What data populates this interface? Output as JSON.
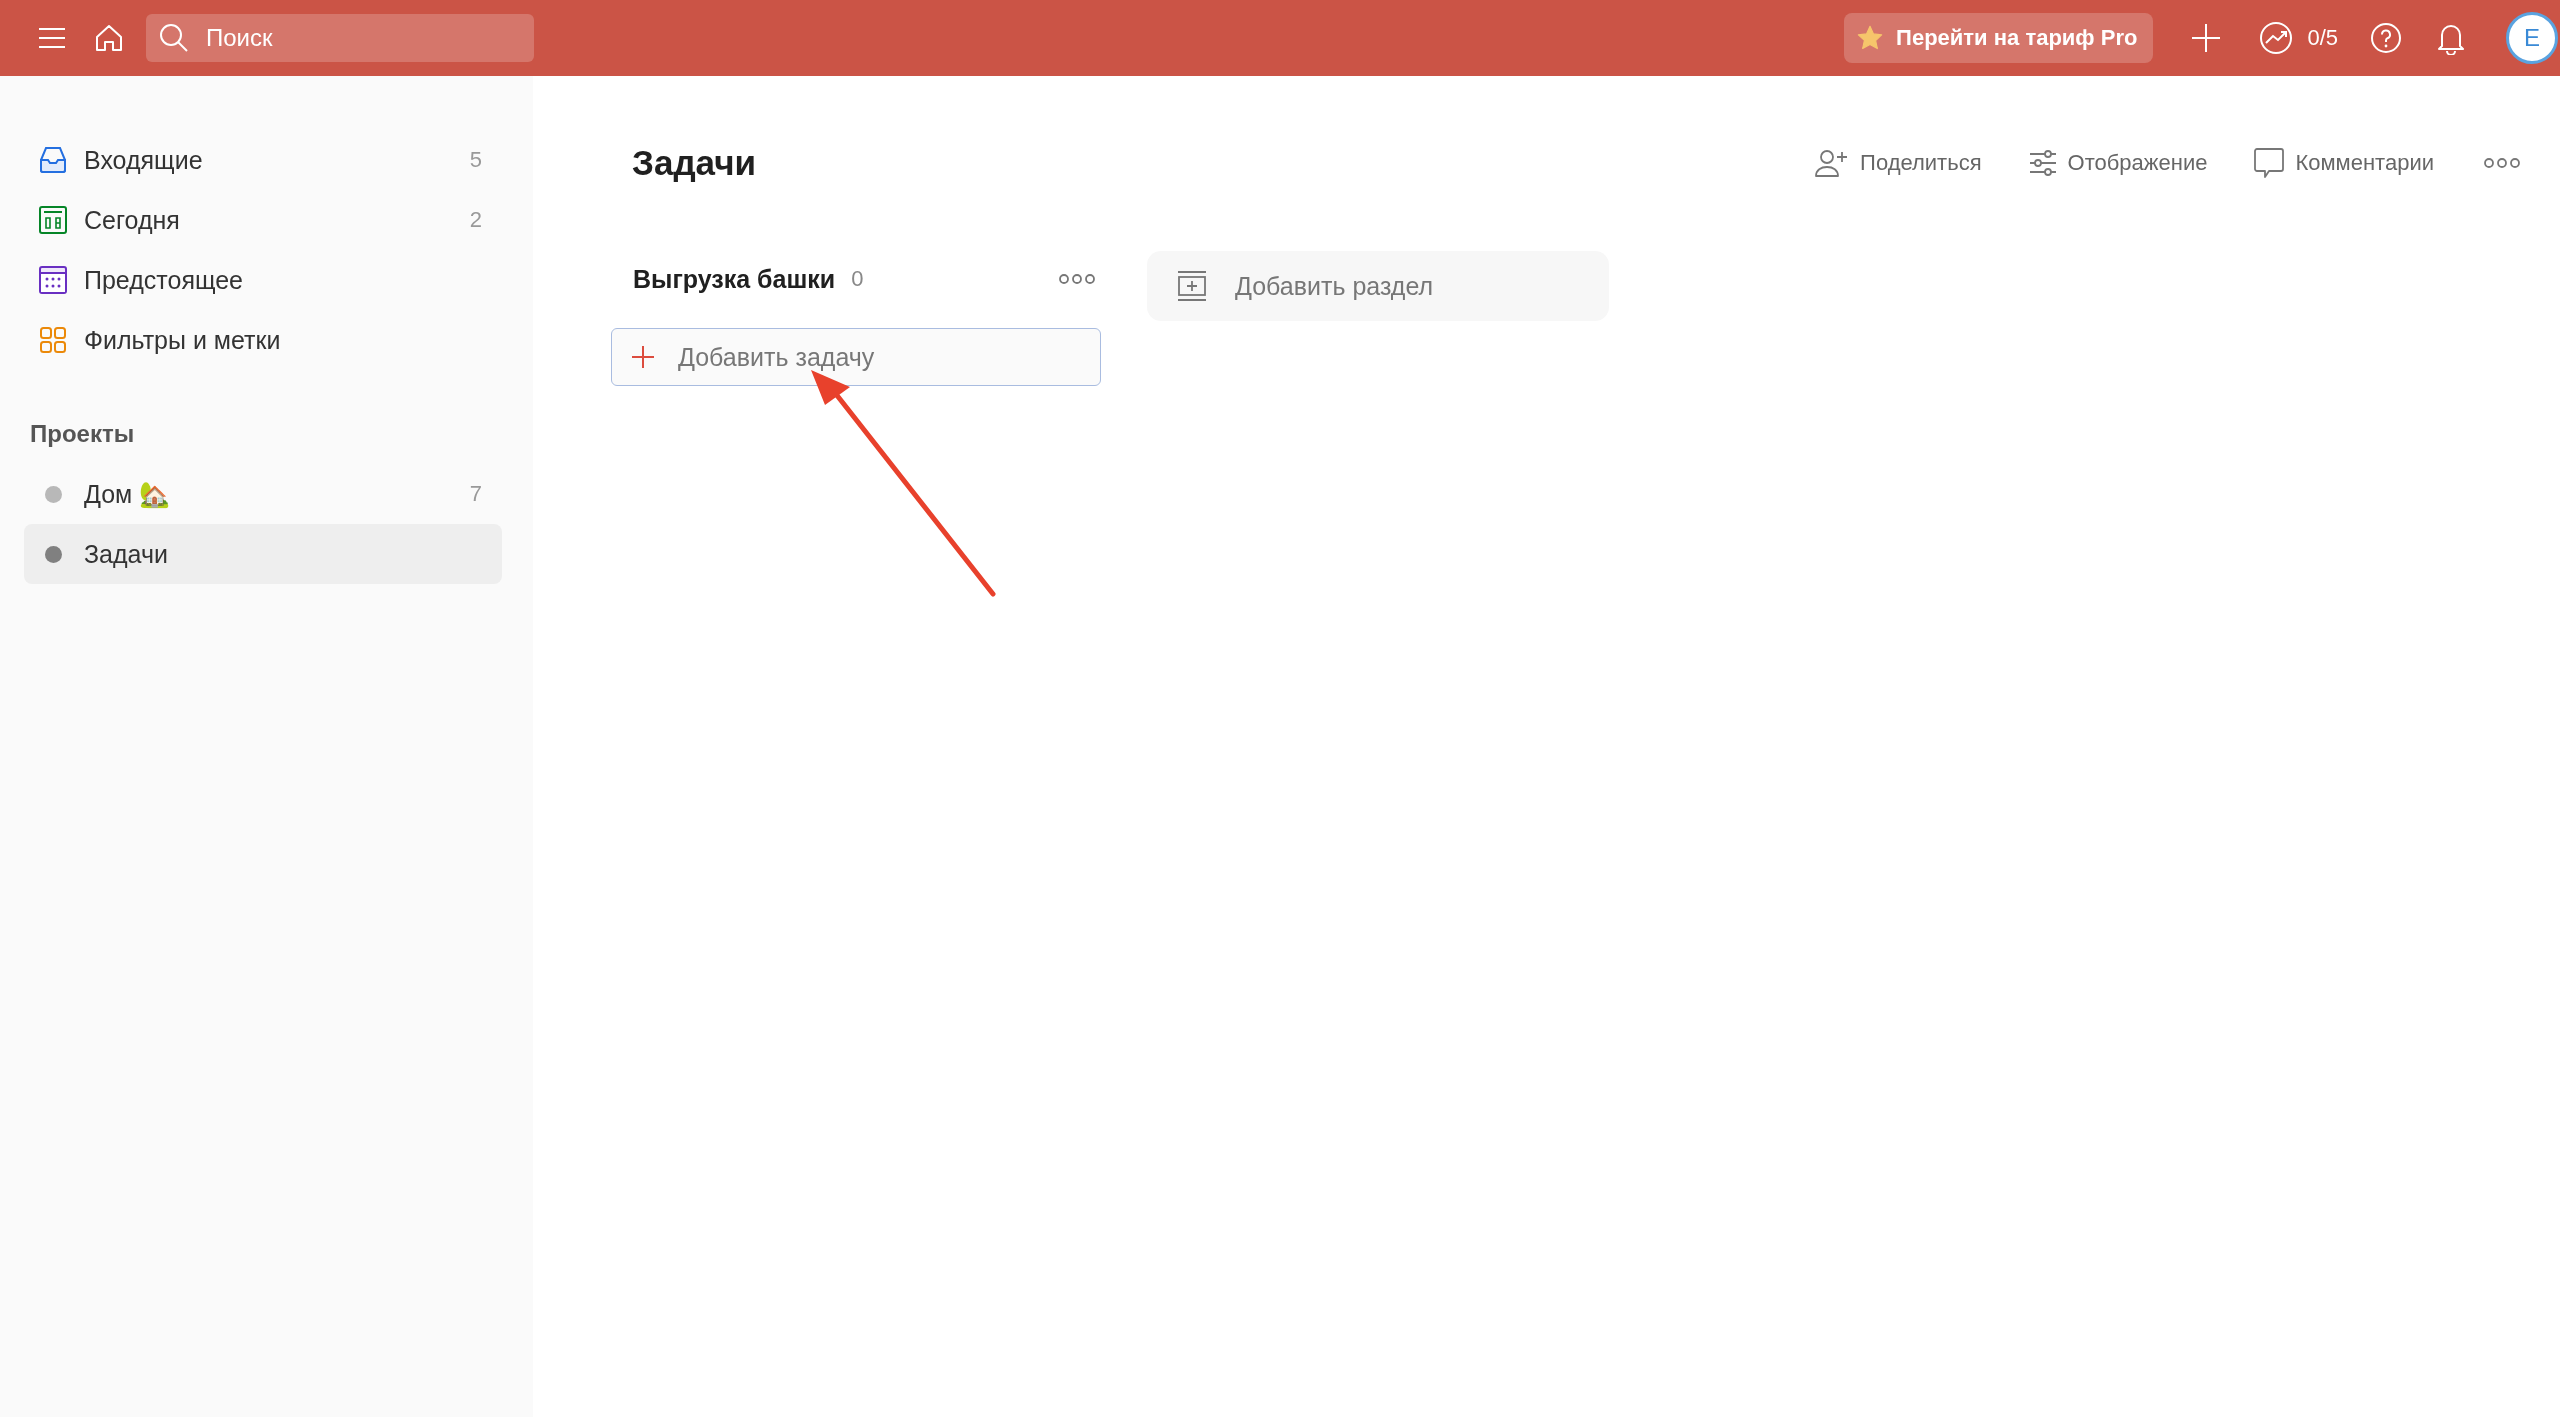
{
  "topbar": {
    "search": {
      "placeholder": "Поиск"
    },
    "upgrade_button": "Перейти на тариф Pro",
    "progress": "0/5",
    "avatar": "E"
  },
  "sidebar": {
    "nav": [
      {
        "kind": "inbox",
        "label": "Входящие",
        "count": "5"
      },
      {
        "kind": "today",
        "label": "Сегодня",
        "count": "2"
      },
      {
        "kind": "upcoming",
        "label": "Предстоящее"
      },
      {
        "kind": "filters",
        "label": "Фильтры и метки"
      }
    ],
    "projects_heading": "Проекты",
    "projects": [
      {
        "name": "Дом 🏡",
        "count": "7",
        "color": "#b8b8b8",
        "selected": false
      },
      {
        "name": "Задачи",
        "color": "#808080",
        "selected": true
      }
    ]
  },
  "page": {
    "title": "Задачи",
    "actions": [
      {
        "kind": "share",
        "label": "Поделиться"
      },
      {
        "kind": "view",
        "label": "Отображение"
      },
      {
        "kind": "comments",
        "label": "Комментарии"
      }
    ],
    "sections": [
      {
        "title": "Выгрузка башки",
        "count": "0",
        "add_task": "Добавить задачу"
      }
    ],
    "add_section": "Добавить раздел"
  }
}
